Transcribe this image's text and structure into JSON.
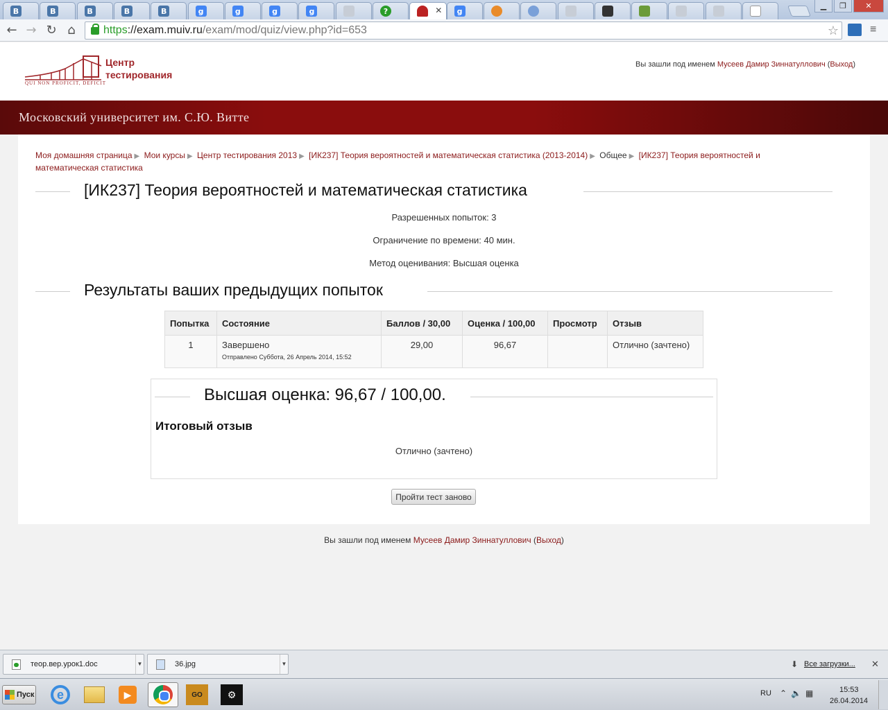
{
  "browser": {
    "tabs": [
      {
        "icon": "vk-icon",
        "glyph": "В",
        "cls": "fav-vk"
      },
      {
        "icon": "vk-icon",
        "glyph": "В",
        "cls": "fav-vk"
      },
      {
        "icon": "vk-icon",
        "glyph": "В",
        "cls": "fav-vk"
      },
      {
        "icon": "vk-icon",
        "glyph": "В",
        "cls": "fav-vk"
      },
      {
        "icon": "vk-icon",
        "glyph": "В",
        "cls": "fav-vk"
      },
      {
        "icon": "google-icon",
        "glyph": "g",
        "cls": "fav-g"
      },
      {
        "icon": "google-icon",
        "glyph": "g",
        "cls": "fav-g"
      },
      {
        "icon": "google-icon",
        "glyph": "g",
        "cls": "fav-g"
      },
      {
        "icon": "google-icon",
        "glyph": "g",
        "cls": "fav-g"
      },
      {
        "icon": "document-icon",
        "glyph": "",
        "cls": "fav-doc"
      },
      {
        "icon": "question-icon",
        "glyph": "?",
        "cls": "fav-q"
      },
      {
        "icon": "graduation-cap-icon",
        "glyph": "",
        "cls": "fav-hat",
        "active": true
      },
      {
        "icon": "google-icon",
        "glyph": "g",
        "cls": "fav-g"
      },
      {
        "icon": "flame-icon",
        "glyph": "",
        "cls": "fav-fire"
      },
      {
        "icon": "circle-logo-icon",
        "glyph": "",
        "cls": "fav-o"
      },
      {
        "icon": "document-icon",
        "glyph": "",
        "cls": "fav-doc"
      },
      {
        "icon": "book-icon",
        "glyph": "",
        "cls": "fav-book"
      },
      {
        "icon": "checkmark-icon",
        "glyph": "",
        "cls": "fav-chk"
      },
      {
        "icon": "document-icon",
        "glyph": "",
        "cls": "fav-doc"
      },
      {
        "icon": "document-icon",
        "glyph": "",
        "cls": "fav-doc"
      },
      {
        "icon": "blank-page-icon",
        "glyph": "",
        "cls": "fav-blank"
      }
    ],
    "url_scheme": "https",
    "url_host": "://exam.muiv.ru",
    "url_path": "/exam/mod/quiz/view.php?id=653"
  },
  "header": {
    "logo_line1": "Центр",
    "logo_line2": "тестирования",
    "logo_motto": "QUI NON PROFICIT, DEFICIT",
    "login_prefix": "Вы зашли под именем",
    "user_name": "Мусеев Дамир Зиннатуллович",
    "logout_label": "Выход"
  },
  "banner": {
    "title": "Московский университет им. С.Ю. Витте"
  },
  "breadcrumb": [
    {
      "label": "Моя домашняя страница",
      "link": true
    },
    {
      "label": "Мои курсы",
      "link": true
    },
    {
      "label": "Центр тестирования 2013",
      "link": true
    },
    {
      "label": "[ИК237] Теория вероятностей и математическая статистика (2013-2014)",
      "link": true
    },
    {
      "label": "Общее",
      "link": false
    },
    {
      "label": "[ИК237] Теория вероятностей и математическая статистика",
      "link": true
    }
  ],
  "quiz": {
    "title": "[ИК237] Теория вероятностей и математическая статистика",
    "attempts_allowed": "Разрешенных попыток: 3",
    "time_limit": "Ограничение по времени: 40 мин.",
    "grading_method": "Метод оценивания: Высшая оценка"
  },
  "results": {
    "heading": "Результаты ваших предыдущих попыток",
    "columns": [
      "Попытка",
      "Состояние",
      "Баллов / 30,00",
      "Оценка / 100,00",
      "Просмотр",
      "Отзыв"
    ],
    "rows": [
      {
        "attempt": "1",
        "state": "Завершено",
        "submitted": "Отправлено Суббота, 26 Апрель 2014, 15:52",
        "marks": "29,00",
        "grade": "96,67",
        "review": "",
        "feedback": "Отлично (зачтено)"
      }
    ]
  },
  "summary": {
    "highest_grade": "Высшая оценка: 96,67 / 100,00.",
    "feedback_heading": "Итоговый отзыв",
    "feedback_text": "Отлично (зачтено)"
  },
  "actions": {
    "retake_label": "Пройти тест заново"
  },
  "footer": {
    "login_prefix": "Вы зашли под именем",
    "user_name": "Мусеев Дамир Зиннатуллович",
    "logout_label": "Выход"
  },
  "downloads": {
    "items": [
      {
        "name": "теор.вер.урок1.doc",
        "icon": "doc"
      },
      {
        "name": "36.jpg",
        "icon": "img"
      }
    ],
    "all_label": "Все загрузки..."
  },
  "taskbar": {
    "start_label": "Пуск",
    "lang": "RU",
    "time": "15:53",
    "date": "26.04.2014"
  },
  "colors": {
    "brand_red": "#8b1a1a",
    "banner_dark": "#5a0a0a"
  }
}
